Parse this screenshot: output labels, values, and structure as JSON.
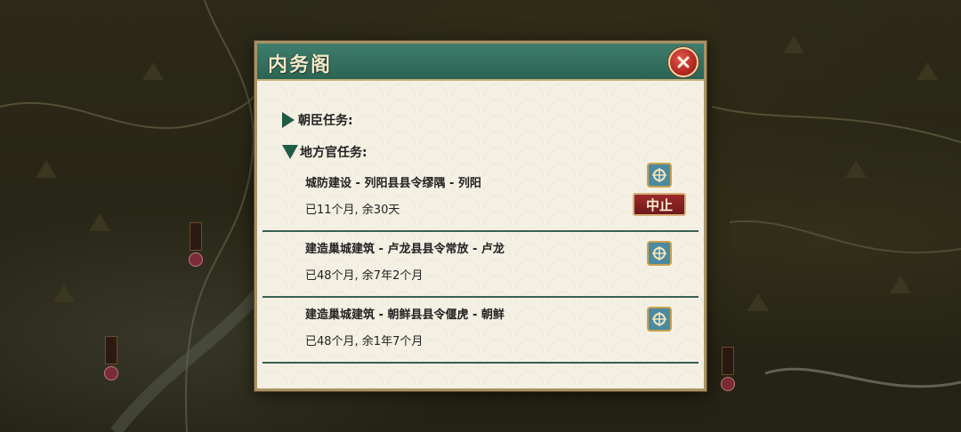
{
  "dialog": {
    "title": "内务阁",
    "close_icon": "close-icon"
  },
  "sections": {
    "court_officials": "朝臣任务:",
    "local_officials": "地方官任务:"
  },
  "tasks": [
    {
      "title": "城防建设 - 列阳县县令缪隅 - 列阳",
      "progress": "已11个月,  余30天",
      "icon": "task-detail-icon",
      "action": "中止"
    },
    {
      "title": "建造巢城建筑 - 卢龙县县令常放 - 卢龙",
      "progress": "已48个月,  余7年2个月",
      "icon": "task-detail-icon"
    },
    {
      "title": "建造巢城建筑 - 朝鲜县县令偃虎 - 朝鲜",
      "progress": "已48个月,  余1年7个月",
      "icon": "task-detail-icon"
    }
  ],
  "colors": {
    "header_green": "#2c6454",
    "stop_red": "#7a1d1d",
    "close_red": "#b42a22"
  }
}
